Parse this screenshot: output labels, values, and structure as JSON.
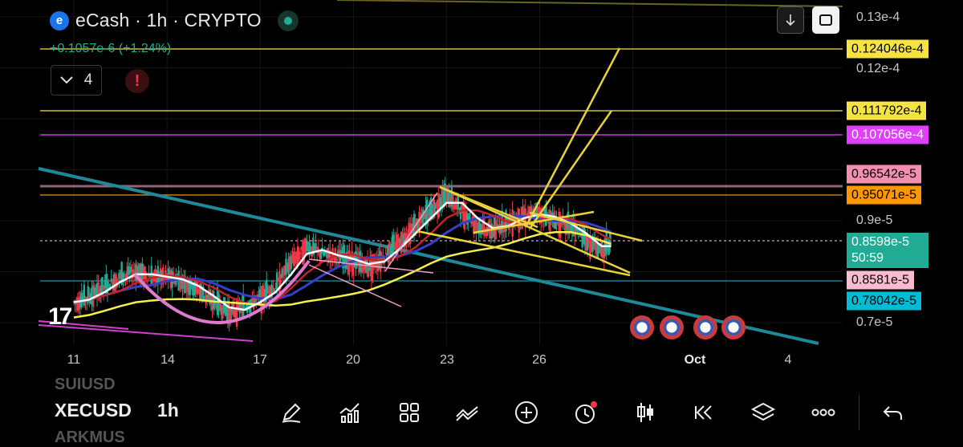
{
  "header": {
    "symbol_title": "eCash · 1h · CRYPTO",
    "logo_letter": "e",
    "change": "+0.1057e-6 (+1.24%)",
    "indicator_count": "4",
    "alert_symbol": "!"
  },
  "price_axis": {
    "ticks": [
      "0.13e-4",
      "0.12e-4",
      "0.9e-5",
      "0.7e-5"
    ],
    "labels": [
      {
        "text": "0.124046e-4",
        "bg": "#f5e342",
        "fg": "#000000"
      },
      {
        "text": "0.111792e-4",
        "bg": "#f5e342",
        "fg": "#000000"
      },
      {
        "text": "0.107056e-4",
        "bg": "#e040fb",
        "fg": "#ffffff"
      },
      {
        "text": "0.96542e-5",
        "bg": "#f48fb1",
        "fg": "#000000"
      },
      {
        "text": "0.95071e-5",
        "bg": "#ff9800",
        "fg": "#000000"
      },
      {
        "text": "0.8581e-5",
        "bg": "#f8bbd0",
        "fg": "#000000"
      },
      {
        "text": "0.78042e-5",
        "bg": "#00bcd4",
        "fg": "#000000"
      }
    ],
    "current_price": "0.8598e-5",
    "countdown": "50:59",
    "current_bg": "#22ab94"
  },
  "time_axis": [
    "11",
    "14",
    "17",
    "20",
    "23",
    "26",
    "Oct",
    "4"
  ],
  "chart_data": {
    "type": "line",
    "symbol": "XECUSD",
    "interval": "1h",
    "x": [
      "11",
      "14",
      "17",
      "20",
      "23",
      "26",
      "Oct",
      "4"
    ],
    "ylim": [
      7e-06,
      1.3e-05
    ],
    "horizontal_levels": [
      1.24046e-05,
      1.11792e-05,
      1.07056e-05,
      9.6542e-06,
      9.5071e-06,
      8.598e-06,
      8.581e-06
    ],
    "close_series": [
      [
        11,
        7.4e-06
      ],
      [
        11.5,
        7.5e-06
      ],
      [
        12,
        7.7e-06
      ],
      [
        12.5,
        7.9e-06
      ],
      [
        13,
        8e-06
      ],
      [
        13.5,
        7.9e-06
      ],
      [
        14,
        7.9e-06
      ],
      [
        14.5,
        7.8e-06
      ],
      [
        15,
        7.65e-06
      ],
      [
        15.5,
        7.4e-06
      ],
      [
        16,
        7.2e-06
      ],
      [
        16.5,
        7.3e-06
      ],
      [
        17,
        7.5e-06
      ],
      [
        17.5,
        7.7e-06
      ],
      [
        18,
        8.2e-06
      ],
      [
        18.5,
        8.5e-06
      ],
      [
        19,
        8.35e-06
      ],
      [
        19.5,
        8.3e-06
      ],
      [
        20,
        8.2e-06
      ],
      [
        20.5,
        8.1e-06
      ],
      [
        21,
        8.3e-06
      ],
      [
        21.5,
        8.6e-06
      ],
      [
        22,
        8.9e-06
      ],
      [
        22.5,
        9.2e-06
      ],
      [
        23,
        9.5e-06
      ],
      [
        23.5,
        9.2e-06
      ],
      [
        24,
        8.9e-06
      ],
      [
        24.5,
        8.8e-06
      ],
      [
        25,
        9e-06
      ],
      [
        25.5,
        9.1e-06
      ],
      [
        26,
        9.15e-06
      ],
      [
        26.5,
        9e-06
      ],
      [
        27,
        8.9e-06
      ],
      [
        27.5,
        8.6e-06
      ],
      [
        28,
        8.4e-06
      ],
      [
        28.3,
        8.6e-06
      ]
    ]
  },
  "bottom": {
    "ghost_top": "SUIUSD",
    "ghost_bottom": "ARKMUS",
    "symbol": "XECUSD",
    "interval": "1h"
  },
  "colors": {
    "up": "#22ab94",
    "down": "#f23645",
    "trend_teal": "#1e8a99",
    "fib_yellow": "#e8d43a",
    "ma_white": "#ffffff",
    "ma_yellow": "#f5f04a",
    "ma_red": "#c0242b",
    "ma_blue": "#3340c8"
  },
  "icons": [
    "pencil-icon",
    "chart-indicators-icon",
    "grid-icon",
    "compare-icon",
    "add-icon",
    "alarm-icon",
    "candles-icon",
    "rewind-icon",
    "layers-icon",
    "more-icon",
    "undo-icon"
  ]
}
